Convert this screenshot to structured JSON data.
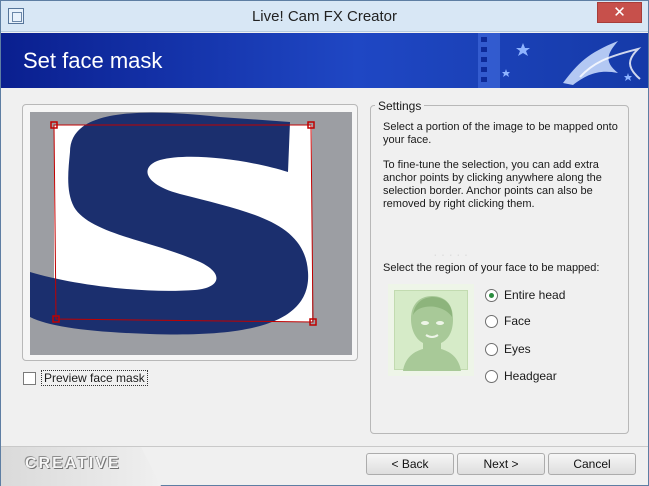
{
  "window": {
    "title": "Live! Cam FX Creator",
    "close_glyph": "✕"
  },
  "header": {
    "title": "Set face mask"
  },
  "preview": {
    "checkbox_label": "Preview face mask",
    "checked": false
  },
  "settings": {
    "legend": "Settings",
    "paragraph1": "Select a portion of the image to be mapped onto your face.",
    "paragraph2": "To fine-tune the selection, you can add extra anchor points by clicking anywhere along the selection border. Anchor points can also be removed by right clicking them.",
    "region_label": "Select the region of your face to be mapped:",
    "options": [
      {
        "label": "Entire head",
        "checked": true
      },
      {
        "label": "Face",
        "checked": false
      },
      {
        "label": "Eyes",
        "checked": false
      },
      {
        "label": "Headgear",
        "checked": false
      }
    ]
  },
  "footer": {
    "brand": "CREATIVE",
    "back_label": "< Back",
    "next_label": "Next >",
    "cancel_label": "Cancel"
  },
  "colors": {
    "header_blue": "#1f47c4",
    "selection_red": "#c00000",
    "letter_navy": "#1b2f6e",
    "radio_green": "#2a8c3e"
  }
}
